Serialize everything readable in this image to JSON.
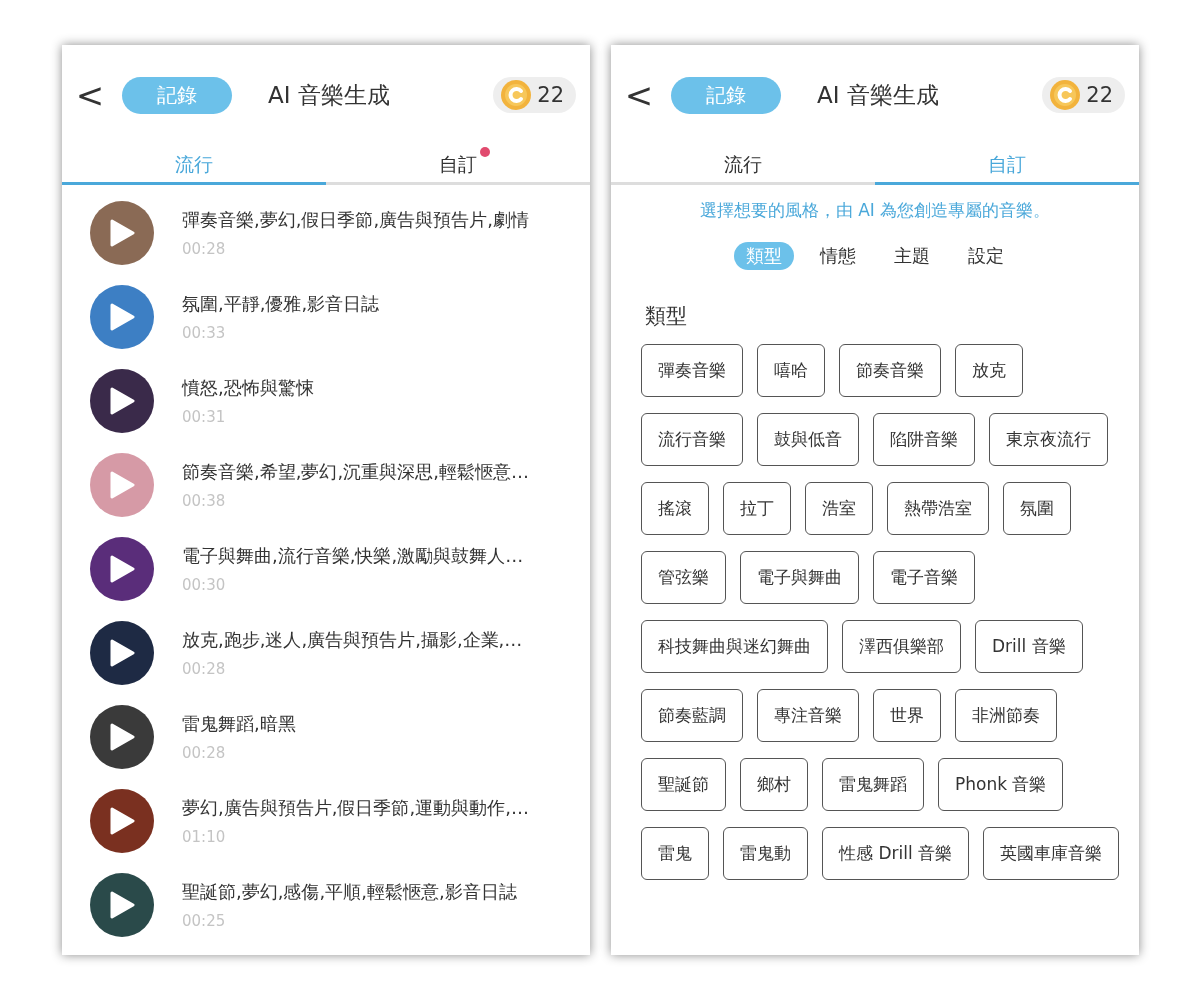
{
  "screens": [
    {
      "header": {
        "back": "<",
        "history_button": "記錄",
        "title": "AI 音樂生成",
        "coins": "22"
      },
      "tabs": [
        {
          "label": "流行",
          "selected": true,
          "dot": false
        },
        {
          "label": "自訂",
          "selected": false,
          "dot": true
        }
      ],
      "tracks": [
        {
          "title": "彈奏音樂,夢幻,假日季節,廣告與預告片,劇情",
          "duration": "00:28"
        },
        {
          "title": "氛圍,平靜,優雅,影音日誌",
          "duration": "00:33"
        },
        {
          "title": "憤怒,恐怖與驚悚",
          "duration": "00:31"
        },
        {
          "title": "節奏音樂,希望,夢幻,沉重與深思,輕鬆愜意…",
          "duration": "00:38"
        },
        {
          "title": "電子與舞曲,流行音樂,快樂,激勵與鼓舞人…",
          "duration": "00:30"
        },
        {
          "title": "放克,跑步,迷人,廣告與預告片,攝影,企業,…",
          "duration": "00:28"
        },
        {
          "title": "雷鬼舞蹈,暗黑",
          "duration": "00:28"
        },
        {
          "title": "夢幻,廣告與預告片,假日季節,運動與動作,…",
          "duration": "01:10"
        },
        {
          "title": "聖誕節,夢幻,感傷,平順,輕鬆愜意,影音日誌",
          "duration": "00:25"
        }
      ]
    },
    {
      "header": {
        "back": "<",
        "history_button": "記錄",
        "title": "AI 音樂生成",
        "coins": "22"
      },
      "tabs": [
        {
          "label": "流行",
          "selected": false,
          "dot": false
        },
        {
          "label": "自訂",
          "selected": true,
          "dot": false
        }
      ],
      "intro": "選擇想要的風格，由 AI 為您創造專屬的音樂。",
      "sub_tabs": [
        {
          "label": "類型",
          "selected": true
        },
        {
          "label": "情態",
          "selected": false
        },
        {
          "label": "主題",
          "selected": false
        },
        {
          "label": "設定",
          "selected": false
        }
      ],
      "section_title": "類型",
      "chips": [
        "彈奏音樂",
        "嘻哈",
        "節奏音樂",
        "放克",
        "流行音樂",
        "鼓與低音",
        "陷阱音樂",
        "東京夜流行",
        "搖滾",
        "拉丁",
        "浩室",
        "熱帶浩室",
        "氛圍",
        "管弦樂",
        "電子與舞曲",
        "電子音樂",
        "科技舞曲與迷幻舞曲",
        "澤西俱樂部",
        "Drill 音樂",
        "節奏藍調",
        "專注音樂",
        "世界",
        "非洲節奏",
        "聖誕節",
        "鄉村",
        "雷鬼舞蹈",
        "Phonk 音樂",
        "雷鬼",
        "雷鬼動",
        "性感 Drill 音樂",
        "英國車庫音樂"
      ]
    }
  ]
}
